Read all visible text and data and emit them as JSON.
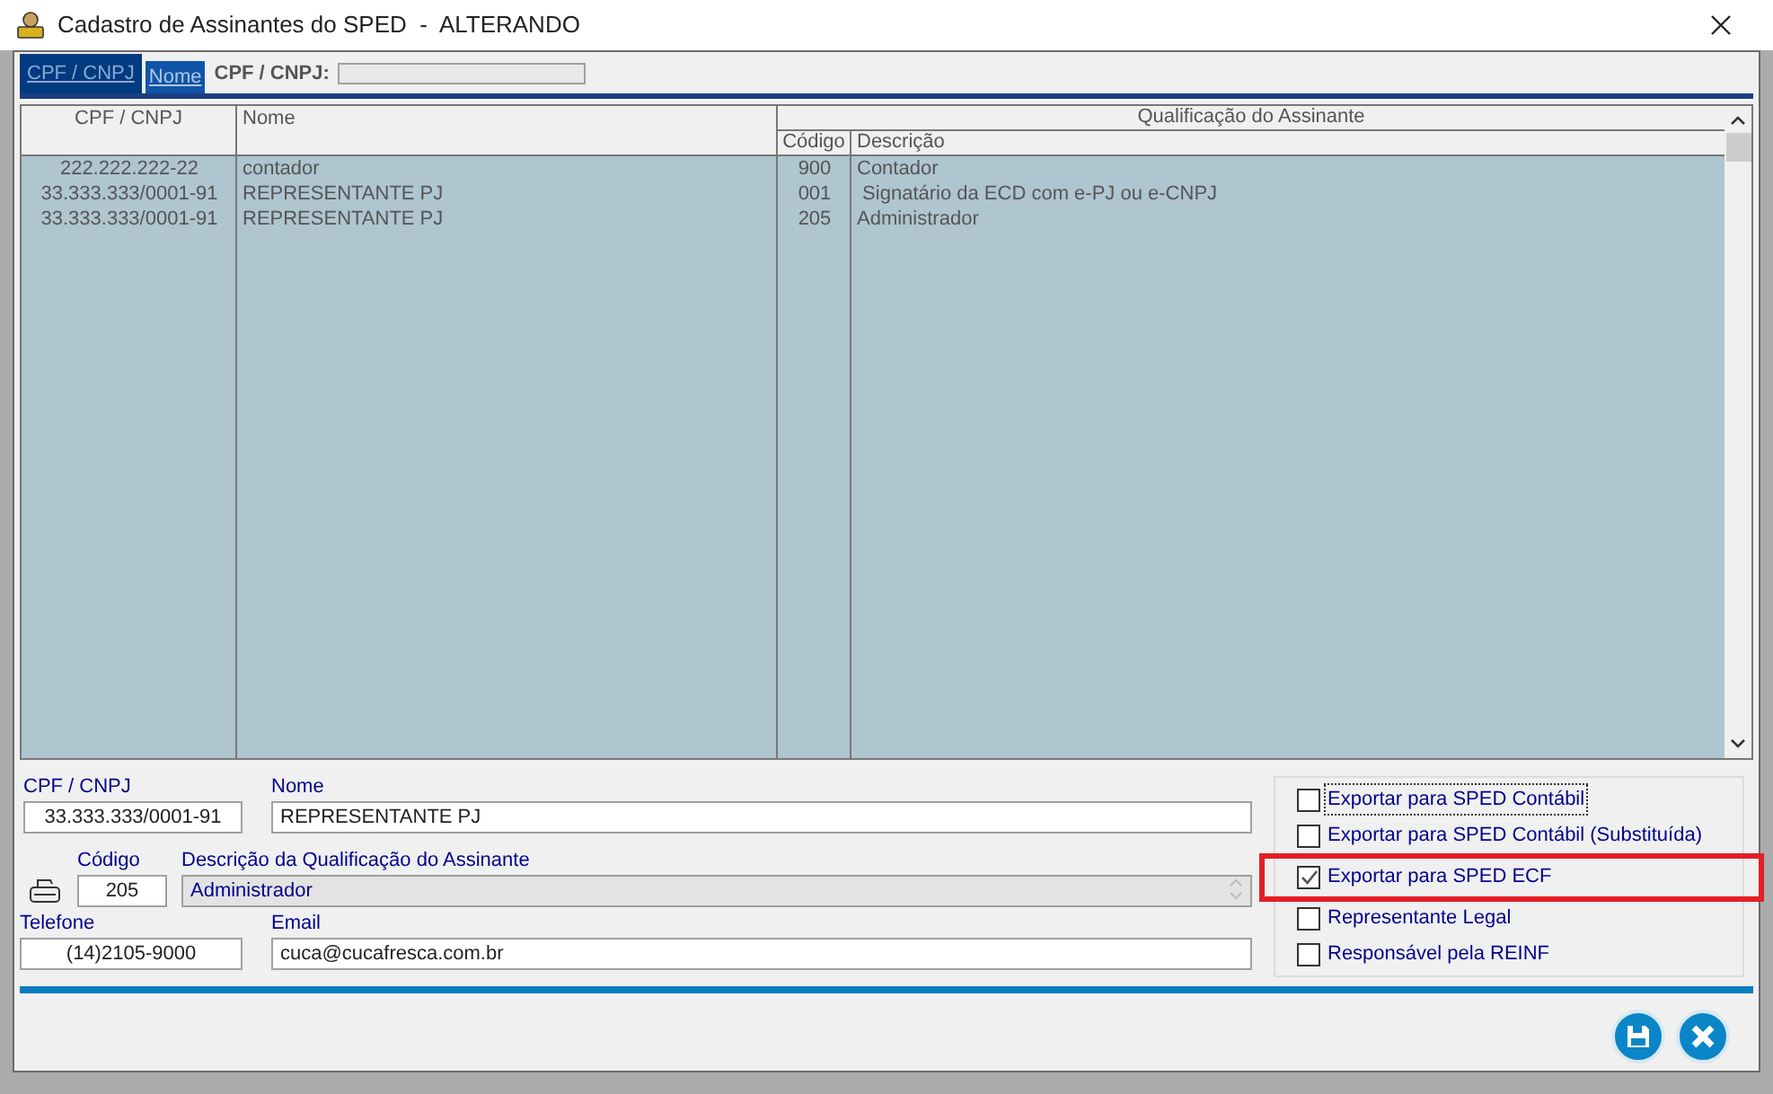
{
  "window": {
    "title": "Cadastro de Assinantes do SPED  -  ALTERANDO"
  },
  "search_tabs": [
    {
      "label": "CPF / CNPJ",
      "selected": true
    },
    {
      "label": "Nome",
      "selected": false
    }
  ],
  "search": {
    "label": "CPF / CNPJ:"
  },
  "table": {
    "group_header": "Qualificação do Assinante",
    "columns": [
      "CPF / CNPJ",
      "Nome",
      "Código",
      "Descrição"
    ],
    "rows": [
      [
        "222.222.222-22",
        "contador",
        "900",
        "Contador"
      ],
      [
        "33.333.333/0001-91",
        "REPRESENTANTE PJ",
        "001",
        " Signatário da ECD com e-PJ ou e-CNPJ"
      ],
      [
        "33.333.333/0001-91",
        "REPRESENTANTE PJ",
        "205",
        "Administrador"
      ]
    ]
  },
  "form": {
    "cpf_label": "CPF / CNPJ",
    "cpf": "33.333.333/0001-91",
    "nome_label": "Nome",
    "nome": "REPRESENTANTE PJ",
    "codigo_label": "Código",
    "codigo": "205",
    "descricao_label": "Descrição da Qualificação do Assinante",
    "descricao": "Administrador",
    "telefone_label": "Telefone",
    "telefone": "(14)2105-9000",
    "email_label": "Email",
    "email": "cuca@cucafresca.com.br"
  },
  "options": [
    {
      "label": "Exportar para SPED Contábil",
      "checked": false,
      "focused": true,
      "highlighted": false
    },
    {
      "label": "Exportar para SPED Contábil (Substituída)",
      "checked": false,
      "focused": false,
      "highlighted": false
    },
    {
      "label": "Exportar para SPED ECF",
      "checked": true,
      "focused": false,
      "highlighted": true
    },
    {
      "label": "Representante Legal",
      "checked": false,
      "focused": false,
      "highlighted": false
    },
    {
      "label": "Responsável pela REINF",
      "checked": false,
      "focused": false,
      "highlighted": false
    }
  ]
}
